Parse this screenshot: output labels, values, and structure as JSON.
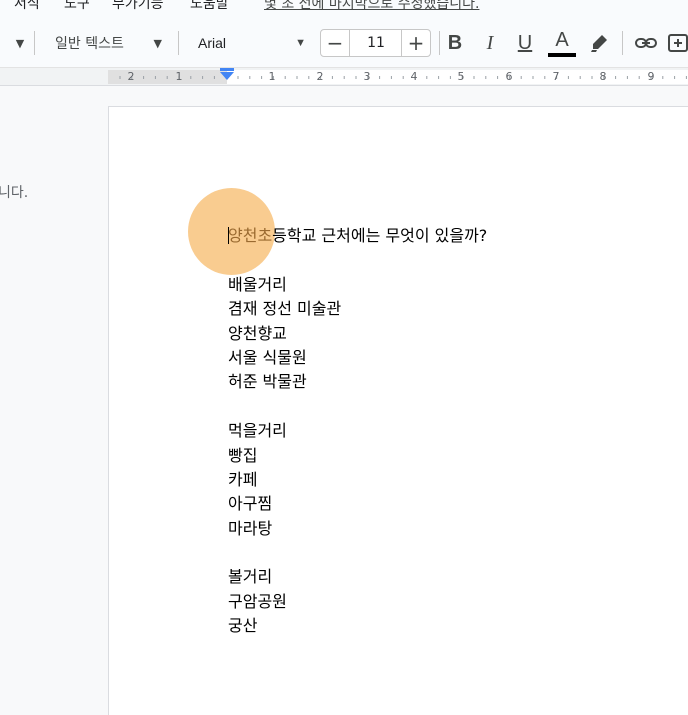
{
  "menubar": {
    "items": [
      "서식",
      "도구",
      "부가기능",
      "도움말"
    ],
    "notice": "몇 초 전에 마지막으로 수정했습니다."
  },
  "toolbar": {
    "paragraph_style": "일반 텍스트",
    "font": "Arial",
    "font_size": "11",
    "decrease": "−",
    "increase": "+",
    "bold": "B",
    "italic": "I",
    "underline": "U",
    "text_color_letter": "A",
    "text_color": "#000000"
  },
  "ruler": {
    "labels": [
      "2",
      "1",
      "1",
      "2",
      "3",
      "4",
      "5",
      "6",
      "7",
      "8",
      "9"
    ]
  },
  "side_panel": {
    "text": "니다."
  },
  "document": {
    "title_highlight": "양천초",
    "title_rest": "등학교 근처에는 무엇이 있을까?",
    "lines": [
      "",
      "배울거리",
      "겸재 정선 미술관",
      "양천향교",
      "서울 식물원",
      "허준 박물관",
      "",
      "먹을거리",
      "빵집",
      "카페",
      "아구찜",
      "마라탕",
      "",
      "볼거리",
      "구암공원",
      "궁산"
    ]
  },
  "colors": {
    "accent": "#4285f4",
    "cursor_highlight": "#f5aa46"
  }
}
